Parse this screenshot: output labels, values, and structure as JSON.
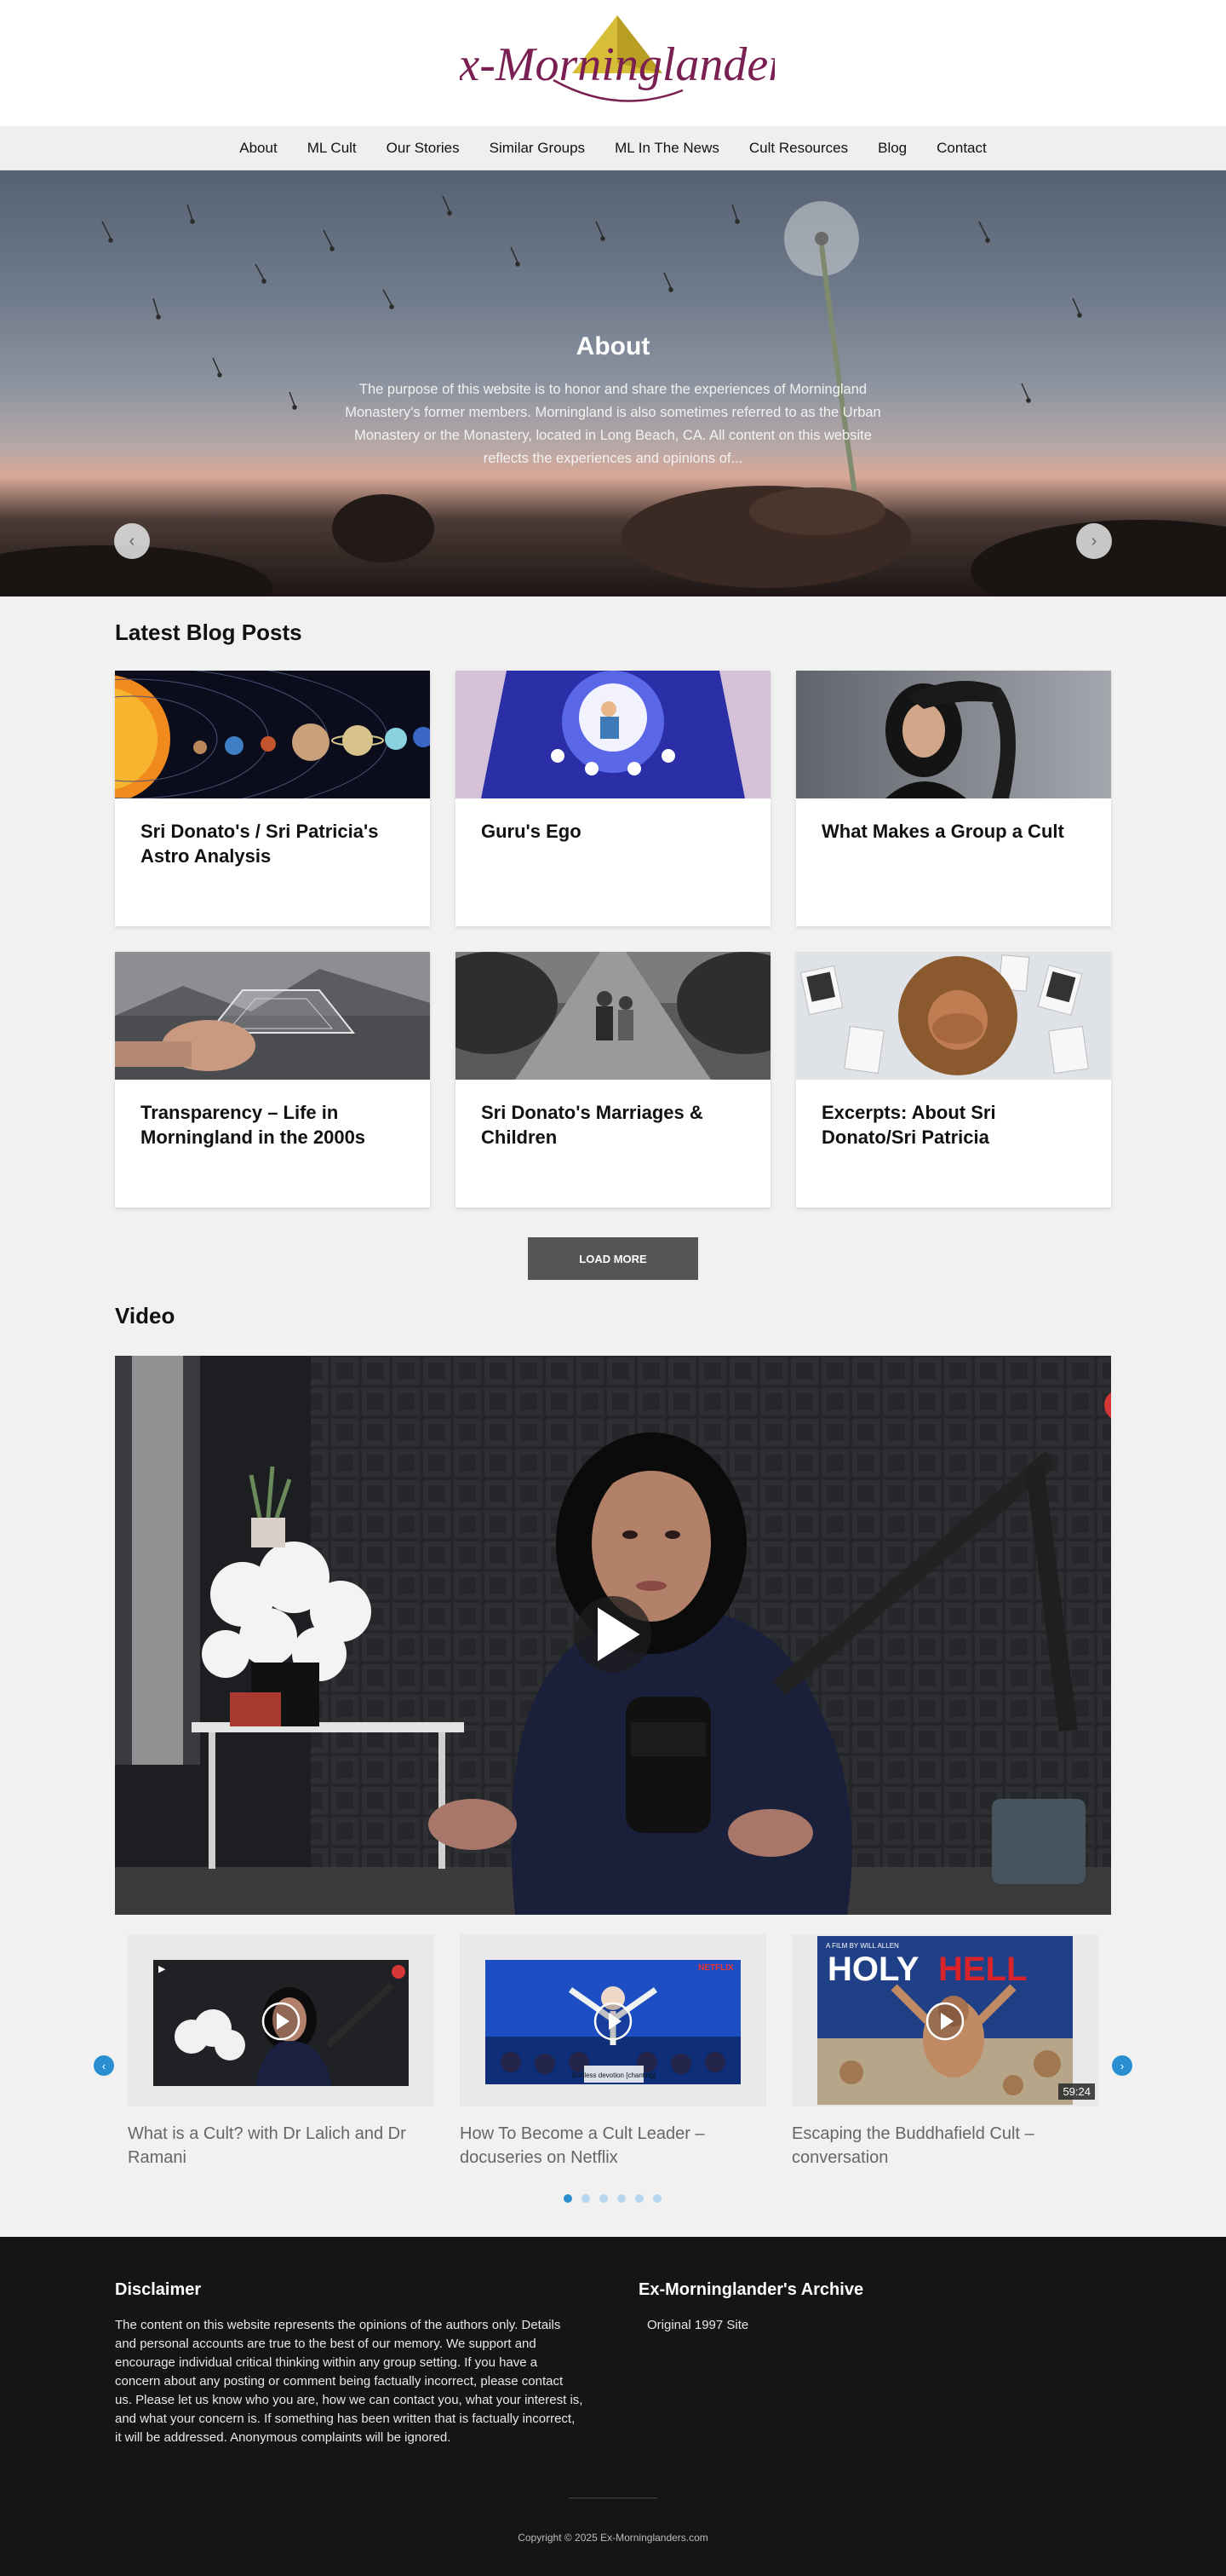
{
  "site": {
    "logo_text": "Ex-Morninglanders"
  },
  "nav": {
    "items": [
      {
        "label": "About"
      },
      {
        "label": "ML Cult"
      },
      {
        "label": "Our Stories"
      },
      {
        "label": "Similar Groups"
      },
      {
        "label": "ML In The News"
      },
      {
        "label": "Cult Resources"
      },
      {
        "label": "Blog"
      },
      {
        "label": "Contact"
      }
    ]
  },
  "hero": {
    "title": "About",
    "text": "The purpose of this website is to honor and share the experiences of Morningland Monastery's former members. Morningland is also sometimes referred to as the Urban Monastery or the Monastery, located in Long Beach, CA. All content on this website reflects the experiences and opinions of...",
    "prev_icon": "‹",
    "next_icon": "›"
  },
  "blog": {
    "heading": "Latest Blog Posts",
    "posts": [
      {
        "title": "Sri Donato's / Sri Patricia's Astro Analysis"
      },
      {
        "title": "Guru's Ego"
      },
      {
        "title": "What Makes a Group a Cult"
      },
      {
        "title": "Transparency – Life in Morningland in the 2000s"
      },
      {
        "title": "Sri Donato's Marriages & Children"
      },
      {
        "title": "Excerpts: About Sri Donato/Sri Patricia"
      }
    ],
    "load_more_label": "LOAD MORE"
  },
  "video": {
    "heading": "Video",
    "items": [
      {
        "title": "What is a Cult? with Dr Lalich and Dr Ramani"
      },
      {
        "title": "How To Become a Cult Leader – docuseries on Netflix"
      },
      {
        "title": "Escaping the Buddhafield Cult – conversation",
        "duration": "59:24"
      }
    ],
    "poster_text": {
      "holy": "HOLY",
      "hell": "HELL",
      "film_by": "A FILM BY WILL ALLEN",
      "netflix": "NETFLIX",
      "caption": "Endless devotion [chanting]"
    },
    "prev_icon": "‹",
    "next_icon": "›",
    "dots_count": 6,
    "active_dot": 0
  },
  "footer": {
    "disclaimer_heading": "Disclaimer",
    "disclaimer_text": "The content on this website represents the opinions of the authors only. Details and personal accounts are true to the best of our memory. We support and encourage individual critical thinking within any group setting. If you have a concern about any posting or comment being factually incorrect, please contact us. Please let us know who you are, how we can contact you, what your interest is, and what your concern is. If something has been written that is factually incorrect, it will be addressed. Anonymous complaints will be ignored.",
    "archive_heading": "Ex-Morninglander's Archive",
    "archive_link": "Original 1997 Site",
    "copyright": "Copyright © 2025 Ex-Morninglanders.com"
  },
  "colors": {
    "logo_text": "#7a1f52",
    "logo_triangle": "#d9c23a",
    "accent": "#2a8fd0",
    "button": "#555555",
    "footer_bg": "#151515"
  }
}
